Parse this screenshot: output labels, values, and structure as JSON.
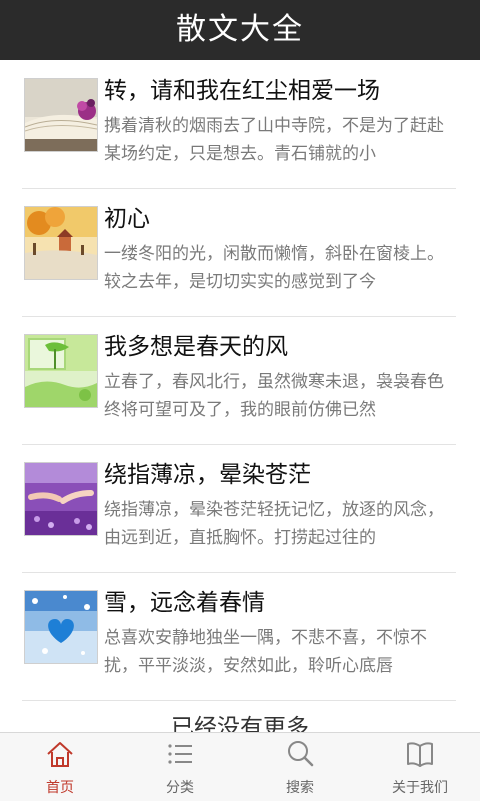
{
  "header": {
    "title": "散文大全"
  },
  "articles": [
    {
      "title": "转，请和我在红尘相爱一场",
      "summary": "携着清秋的烟雨去了山中寺院，不是为了赶赴某场约定，只是想去。青石铺就的小",
      "thumb": "book-flower-thumbnail"
    },
    {
      "title": "初心",
      "summary": "一缕冬阳的光，闲散而懒惰，斜卧在窗棱上。较之去年，是切切实实的感觉到了今",
      "thumb": "autumn-landscape-thumbnail"
    },
    {
      "title": "我多想是春天的风",
      "summary": "立春了，春风北行，虽然微寒未退，袅袅春色终将可望可及了，我的眼前仿佛已然",
      "thumb": "green-spring-thumbnail"
    },
    {
      "title": "绕指薄凉，晕染苍茫",
      "summary": "绕指薄凉，晕染苍茫轻抚记忆，放逐的风念，由远到近，直抵胸怀。打捞起过往的",
      "thumb": "hands-lavender-thumbnail"
    },
    {
      "title": "雪，远念着春情",
      "summary": "总喜欢安静地独坐一隅，不悲不喜，不惊不扰，平平淡淡，安然如此，聆听心底唇",
      "thumb": "blue-heart-snow-thumbnail"
    }
  ],
  "list_end": {
    "text": "已经没有更多"
  },
  "tabbar": {
    "active_color": "#c0392b",
    "tabs": [
      {
        "label": "首页",
        "icon": "home-icon",
        "active": true
      },
      {
        "label": "分类",
        "icon": "list-icon",
        "active": false
      },
      {
        "label": "搜索",
        "icon": "search-icon",
        "active": false
      },
      {
        "label": "关于我们",
        "icon": "book-icon",
        "active": false
      }
    ]
  }
}
